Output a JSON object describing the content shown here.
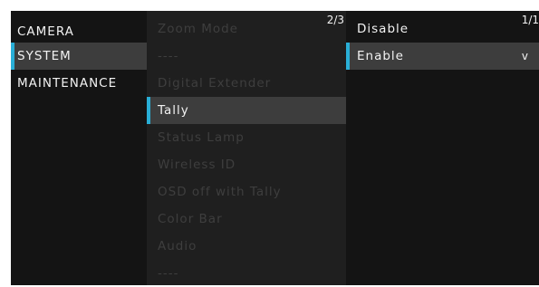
{
  "menu": {
    "categories": [
      "CAMERA",
      "SYSTEM",
      "MAINTENANCE"
    ],
    "selected_category": "SYSTEM"
  },
  "system_list": {
    "page_indicator": "2/3",
    "items": [
      "Zoom Mode",
      "----",
      "Digital Extender",
      "Tally",
      "Status Lamp",
      "Wireless ID",
      "OSD off with Tally",
      "Color Bar",
      "Audio",
      "----"
    ],
    "selected_item": "Tally"
  },
  "tally_options": {
    "page_indicator": "1/1",
    "items": [
      "Disable",
      "Enable"
    ],
    "selected_item": "Enable",
    "check_mark": "v"
  },
  "colors": {
    "accent": "#29aed6",
    "background": "#141414",
    "middle_panel": "#1f1f1f",
    "highlight": "#3d3d3d",
    "disabled_text": "#3e3e3e"
  }
}
